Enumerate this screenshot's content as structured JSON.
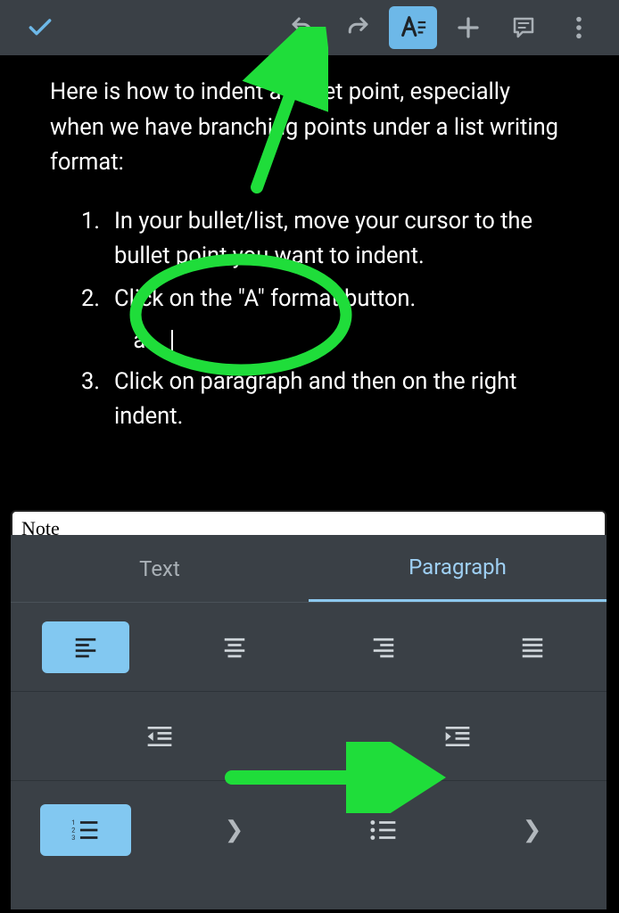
{
  "toolbar": {
    "items": [
      "check",
      "undo",
      "redo",
      "format",
      "add",
      "comment",
      "more"
    ]
  },
  "doc": {
    "intro": "Here is how to indent a bullet point, especially when we have branching points under a list writing format:",
    "list": [
      {
        "n": "1.",
        "text": "In your bullet/list, move your cursor to the bullet point you want to indent."
      },
      {
        "n": "2.",
        "text": "Click on the \"A\" format button."
      },
      {
        "n": "3.",
        "text": "Click on paragraph and then on the right indent."
      }
    ],
    "sub": {
      "n": "a.",
      "text": ""
    }
  },
  "tab_peek": "Note",
  "panel": {
    "tabs": {
      "left": "Text",
      "right": "Paragraph",
      "active": "right"
    }
  }
}
